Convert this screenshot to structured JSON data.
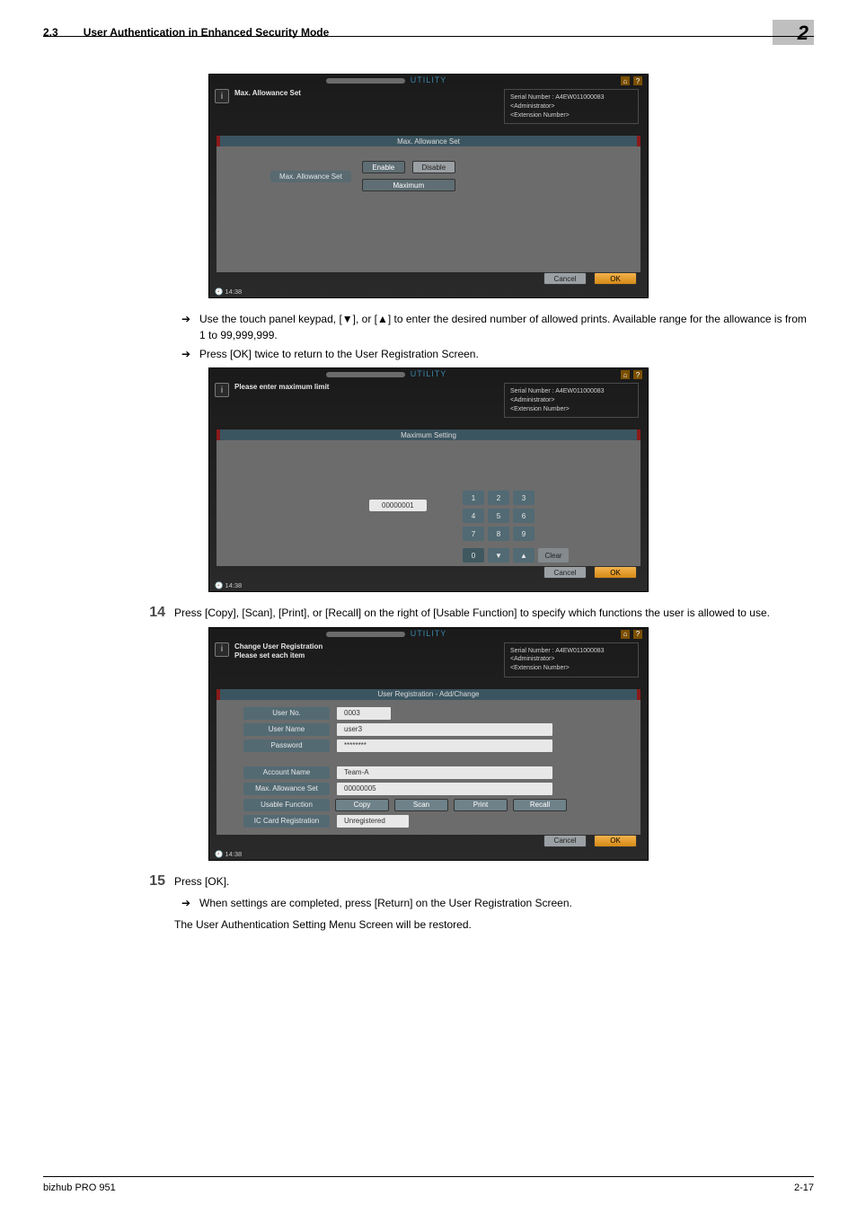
{
  "header": {
    "section_no": "2.3",
    "section_title": "User Authentication in Enhanced Security Mode",
    "chapter": "2"
  },
  "ss_common": {
    "utility": "UTILITY",
    "serial_lbl": "Serial Number",
    "serial": "A4EW011000083",
    "admin": "<Administrator>",
    "ext": "<Extension Number>",
    "time": "14:38",
    "home_sym": "⌂",
    "help_sym": "?",
    "cancel": "Cancel",
    "ok": "OK"
  },
  "ss1": {
    "info": "Max. Allowance Set",
    "strip": "Max. Allowance Set",
    "chip": "Max. Allowance Set",
    "enable": "Enable",
    "disable": "Disable",
    "maximum": "Maximum"
  },
  "mid_bullets": {
    "b1": "Use the touch panel keypad, [▼], or [▲] to enter the desired number of allowed prints. Available range for the allowance is from 1 to 99,999,999.",
    "b2": "Press [OK] twice to return to the User Registration Screen."
  },
  "ss2": {
    "info": "Please enter maximum limit",
    "strip": "Maximum Setting",
    "value": "00000001",
    "k1": "1",
    "k2": "2",
    "k3": "3",
    "k4": "4",
    "k5": "5",
    "k6": "6",
    "k7": "7",
    "k8": "8",
    "k9": "9",
    "k0": "0",
    "down": "▼",
    "up": "▲",
    "clear": "Clear"
  },
  "step14": {
    "num": "14",
    "text": "Press [Copy], [Scan], [Print], or [Recall] on the right of [Usable Function] to specify which functions the user is allowed to use."
  },
  "ss3": {
    "info1": "Change User Registration",
    "info2": "Please set each item",
    "strip": "User Registration - Add/Change",
    "user_no_lbl": "User No.",
    "user_no": "0003",
    "user_name_lbl": "User Name",
    "user_name": "user3",
    "password_lbl": "Password",
    "password": "********",
    "account_lbl": "Account Name",
    "account": "Team-A",
    "max_lbl": "Max. Allowance Set",
    "max": "00000005",
    "usable_lbl": "Usable Function",
    "copy": "Copy",
    "scan": "Scan",
    "print": "Print",
    "recall": "Recall",
    "ic_lbl": "IC Card Registration",
    "ic_val": "Unregistered"
  },
  "step15": {
    "num": "15",
    "text": "Press [OK].",
    "b1": "When settings are completed, press [Return] on the User Registration Screen.",
    "line": "The User Authentication Setting Menu Screen will be restored."
  },
  "footer": {
    "left": "bizhub PRO 951",
    "right": "2-17"
  }
}
